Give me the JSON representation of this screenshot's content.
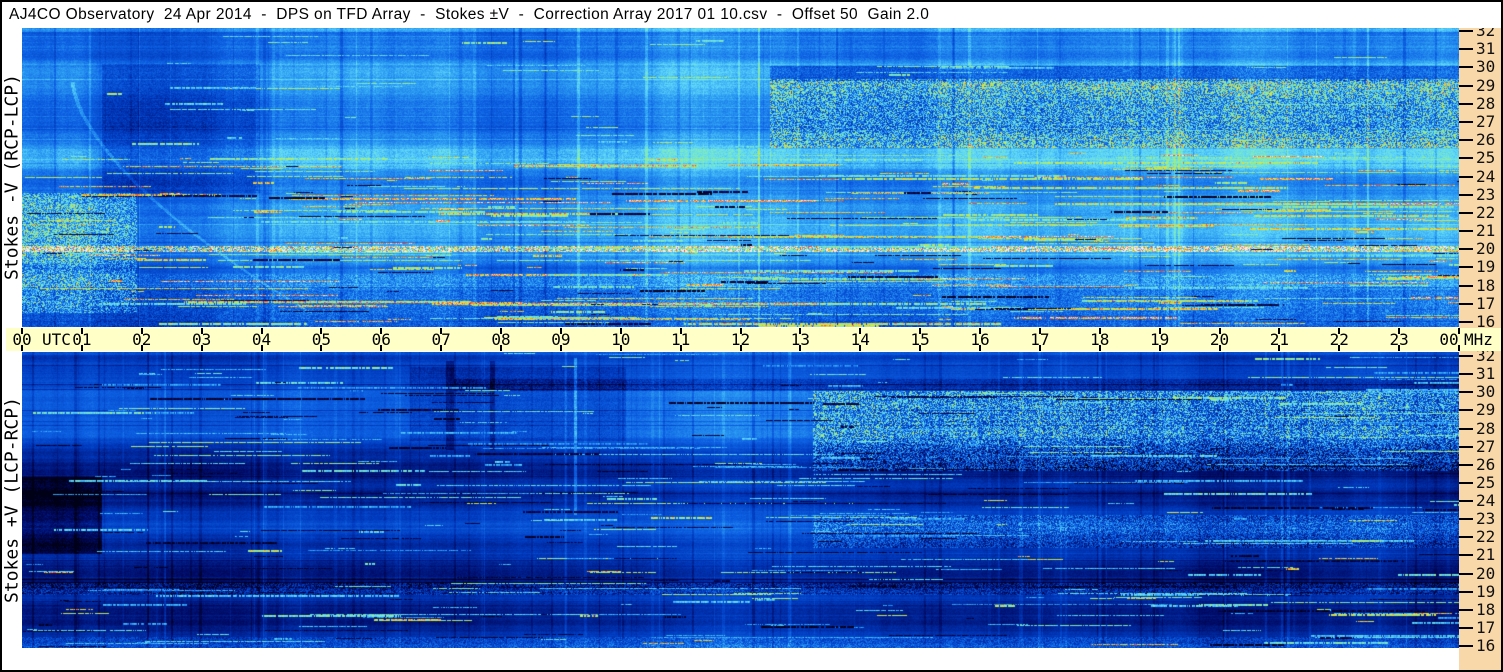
{
  "window": {
    "title": "AJ4CO Observatory  24 Apr 2014  -  DPS on TFD Array  -  Stokes ±V  -  Correction Array 2017 01 10.csv  -  Offset 50  Gain 2.0"
  },
  "panels": [
    {
      "label": "Stokes -V (RCP-LCP)"
    },
    {
      "label": "Stokes +V (LCP-RCP)"
    }
  ],
  "time_axis": {
    "unit_left": "UTC",
    "unit_right": "MHz",
    "hours": [
      "00",
      "01",
      "02",
      "03",
      "04",
      "05",
      "06",
      "07",
      "08",
      "09",
      "10",
      "11",
      "12",
      "13",
      "14",
      "15",
      "16",
      "17",
      "18",
      "19",
      "20",
      "21",
      "22",
      "23",
      "00"
    ]
  },
  "freq_axis": {
    "unit": "MHz",
    "labels": [
      "32",
      "31",
      "30",
      "29",
      "28",
      "27",
      "26",
      "25",
      "24",
      "23",
      "22",
      "21",
      "20",
      "19",
      "18",
      "17",
      "16"
    ]
  },
  "colors": {
    "border": "#000000",
    "window_bg": "#ffffff",
    "title_fg": "#000000",
    "time_axis_bg": "#ffffc8",
    "freq_axis_bg": "#f8d8a8",
    "tick": "#000000",
    "spectrum_base_top": "#0e62e4",
    "spectrum_base_bottom": "#0030b8"
  },
  "chart_data": [
    {
      "type": "heatmap",
      "title": "Stokes -V (RCP-LCP)",
      "xlabel": "UTC",
      "ylabel": "MHz",
      "x_range": [
        0,
        24
      ],
      "x_ticks": [
        "00",
        "01",
        "02",
        "03",
        "04",
        "05",
        "06",
        "07",
        "08",
        "09",
        "10",
        "11",
        "12",
        "13",
        "14",
        "15",
        "16",
        "17",
        "18",
        "19",
        "20",
        "21",
        "22",
        "23",
        "00"
      ],
      "y_range": [
        16,
        32
      ],
      "y_ticks": [
        32,
        31,
        30,
        29,
        28,
        27,
        26,
        25,
        24,
        23,
        22,
        21,
        20,
        19,
        18,
        17,
        16
      ],
      "legend_position": "none",
      "grid": false,
      "description": "24-hour radio dynamic spectrum, 16-32 MHz. Mid-blue noise background with fine horizontal striping; dense speckled activity band 26-29 MHz from ~13:00 UTC onward; red/pink RFI line near 20.3 MHz across full day; many yellow/green/cyan horizontal RFI segments below 24 MHz; dark vertical fade 01:00-04:00."
    },
    {
      "type": "heatmap",
      "title": "Stokes +V (LCP-RCP)",
      "xlabel": "UTC",
      "ylabel": "MHz",
      "x_range": [
        0,
        24
      ],
      "x_ticks": [
        "00",
        "01",
        "02",
        "03",
        "04",
        "05",
        "06",
        "07",
        "08",
        "09",
        "10",
        "11",
        "12",
        "13",
        "14",
        "15",
        "16",
        "17",
        "18",
        "19",
        "20",
        "21",
        "22",
        "23",
        "00"
      ],
      "y_range": [
        16,
        32
      ],
      "y_ticks": [
        32,
        31,
        30,
        29,
        28,
        27,
        26,
        25,
        24,
        23,
        22,
        21,
        20,
        19,
        18,
        17,
        16
      ],
      "legend_position": "none",
      "grid": false,
      "description": "Darker deep-blue dynamic spectrum with black dropout patches; bright cyan speckled activity band 26-29 MHz after ~14:00 UTC; cyan RFI segments 20-22 MHz; black blotch near 00:00-01:30 around 21-25 MHz; sparse warm-colored RFI."
    }
  ],
  "render": {
    "colormap": [
      [
        0.0,
        0,
        0,
        22
      ],
      [
        0.12,
        0,
        10,
        100
      ],
      [
        0.3,
        0,
        58,
        190
      ],
      [
        0.45,
        14,
        98,
        228
      ],
      [
        0.58,
        45,
        158,
        243
      ],
      [
        0.68,
        95,
        215,
        250
      ],
      [
        0.76,
        130,
        238,
        180
      ],
      [
        0.82,
        180,
        235,
        85
      ],
      [
        0.88,
        238,
        225,
        55
      ],
      [
        0.93,
        246,
        148,
        38
      ],
      [
        0.965,
        242,
        60,
        50
      ],
      [
        1.0,
        255,
        235,
        235
      ]
    ],
    "panels": [
      {
        "seed": 1234,
        "base": 0.47,
        "rowWalk": 0.05,
        "rowMin": 0.37,
        "rowMax": 0.58,
        "stripeProb": 0.11,
        "stripeAmp": 0.16,
        "stripeBias": 0.45,
        "noise": 0.07,
        "colWalk": 0.016,
        "vstreaks": 110,
        "vstreakAmp": 0.2,
        "features": [
          {
            "x0": 0,
            "x1": 1,
            "y0": 0,
            "y1": 0.012,
            "boost": 0.12,
            "speckle": 0
          },
          {
            "x0": 0.055,
            "x1": 0.165,
            "y0": 0.12,
            "y1": 0.55,
            "boost": -0.1,
            "speckle": 0.06
          },
          {
            "x0": 0.52,
            "x1": 1,
            "y0": 0.17,
            "y1": 0.4,
            "boost": 0.05,
            "speckle": 0.32
          },
          {
            "x0": 0.52,
            "x1": 1,
            "y0": 0.125,
            "y1": 0.175,
            "boost": -0.16,
            "speckle": 0.1
          },
          {
            "x0": 0,
            "x1": 0.08,
            "y0": 0.55,
            "y1": 0.95,
            "boost": 0.1,
            "speckle": 0.28
          },
          {
            "x0": 0,
            "x1": 1,
            "y0": 0.728,
            "y1": 0.746,
            "boost": 0.28,
            "speckle": 0.4
          },
          {
            "x0": 0,
            "x1": 1,
            "y0": 0.4,
            "y1": 0.47,
            "boost": 0.05,
            "speckle": 0.03
          },
          {
            "x0": 0,
            "x1": 1,
            "y0": 0.82,
            "y1": 1,
            "boost": 0.03,
            "speckle": 0.12
          },
          {
            "x0": 0.512,
            "x1": 0.5135,
            "y0": 0,
            "y1": 1,
            "boost": 0.15,
            "speckle": 0
          },
          {
            "diag": 1,
            "x0": 0.035,
            "x1": 0.2,
            "y0": 0.18,
            "y1": 0.95,
            "w": 2,
            "boost": 0.1
          }
        ],
        "rfi": [
          {
            "count": 300,
            "yMin": 0.42,
            "yMax": 1,
            "lenMax": 380,
            "intMin": 0.72,
            "intMax": 0.97
          },
          {
            "count": 45,
            "yMin": 0,
            "yMax": 0.42,
            "lenMax": 200,
            "intMin": 0.65,
            "intMax": 0.82
          },
          {
            "count": 80,
            "yMin": 0.45,
            "yMax": 1,
            "lenMax": 200,
            "intMin": 0.02,
            "intMax": 0.1
          }
        ]
      },
      {
        "seed": 987,
        "base": 0.3,
        "rowWalk": 0.06,
        "rowMin": 0.16,
        "rowMax": 0.44,
        "stripeProb": 0.15,
        "stripeAmp": 0.2,
        "stripeBias": 0.7,
        "noise": 0.05,
        "colWalk": 0.014,
        "vstreaks": 130,
        "vstreakAmp": 0.18,
        "features": [
          {
            "x0": 0,
            "x1": 1,
            "y0": 0,
            "y1": 0.01,
            "boost": 0.08,
            "speckle": 0
          },
          {
            "x0": 0.55,
            "x1": 1,
            "y0": 0.13,
            "y1": 0.4,
            "boost": 0.08,
            "speckle": 0.36
          },
          {
            "x0": 0.3,
            "x1": 1,
            "y0": 0.09,
            "y1": 0.13,
            "boost": -0.12,
            "speckle": 0.08
          },
          {
            "x0": 0,
            "x1": 0.055,
            "y0": 0.42,
            "y1": 0.68,
            "boost": -0.2,
            "speckle": 0.05
          },
          {
            "x0": 0.384,
            "x1": 0.386,
            "y0": 0.02,
            "y1": 0.55,
            "boost": 0.22,
            "speckle": 0
          },
          {
            "x0": 0.55,
            "x1": 1,
            "y0": 0.55,
            "y1": 0.66,
            "boost": 0.05,
            "speckle": 0.25
          },
          {
            "x0": 0,
            "x1": 1,
            "y0": 0.78,
            "y1": 0.82,
            "boost": 0,
            "speckle": 0.2
          },
          {
            "x0": 0,
            "x1": 1,
            "y0": 0.96,
            "y1": 1,
            "boost": 0.05,
            "speckle": 0.15
          },
          {
            "x0": 0.27,
            "x1": 0.42,
            "y0": 0.05,
            "y1": 0.3,
            "boost": -0.08,
            "speckle": 0.05
          },
          {
            "x0": 0.295,
            "x1": 0.3,
            "y0": 0.03,
            "y1": 0.33,
            "boost": -0.14,
            "speckle": 0
          },
          {
            "x0": 0.325,
            "x1": 0.329,
            "y0": 0.03,
            "y1": 0.33,
            "boost": -0.12,
            "speckle": 0
          }
        ],
        "rfi": [
          {
            "count": 260,
            "yMin": 0,
            "yMax": 1,
            "lenMax": 320,
            "intMin": 0.55,
            "intMax": 0.8
          },
          {
            "count": 30,
            "yMin": 0.5,
            "yMax": 1,
            "lenMax": 150,
            "intMin": 0.8,
            "intMax": 0.92
          },
          {
            "count": 120,
            "yMin": 0.1,
            "yMax": 1,
            "lenMax": 260,
            "intMin": 0.02,
            "intMax": 0.1
          }
        ]
      }
    ]
  }
}
